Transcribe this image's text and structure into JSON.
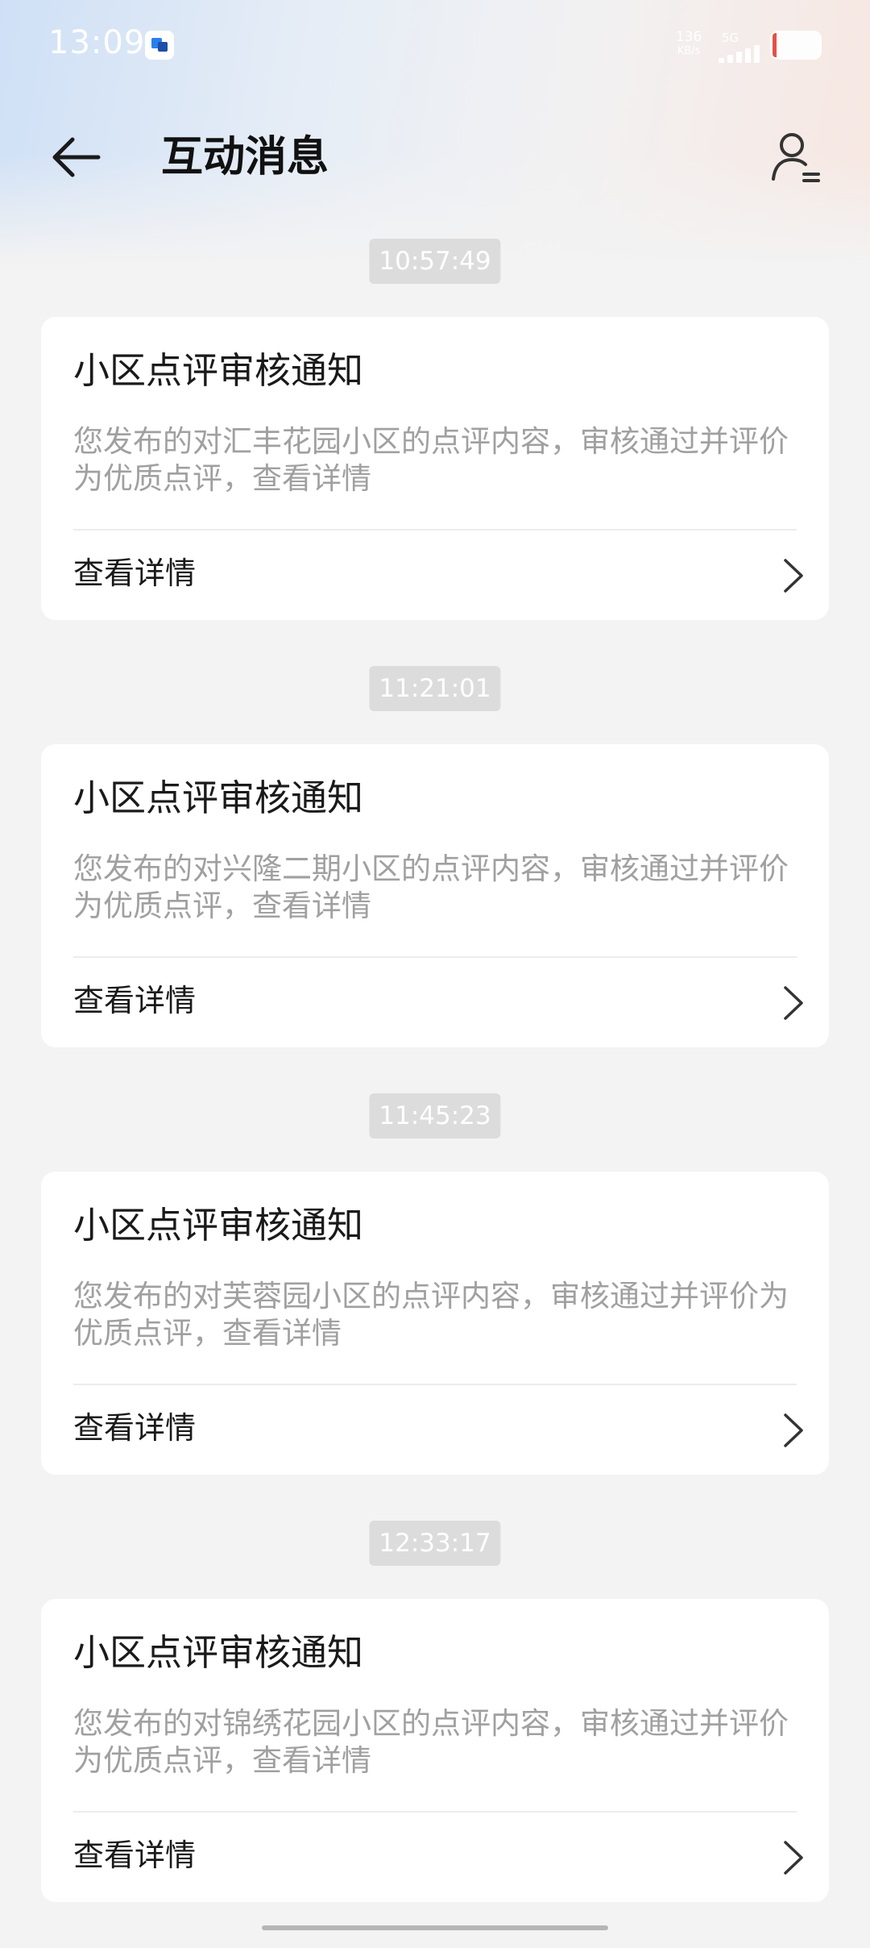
{
  "status_bar": {
    "time": "13:09",
    "net_speed_value": "136",
    "net_speed_unit": "KB/s",
    "network_type": "5G"
  },
  "header": {
    "title": "互动消息"
  },
  "messages": [
    {
      "timestamp": "10:57:49",
      "title": "小区点评审核通知",
      "description": "您发布的对汇丰花园小区的点评内容，审核通过并评价为优质点评，查看详情",
      "link_label": "查看详情"
    },
    {
      "timestamp": "11:21:01",
      "title": "小区点评审核通知",
      "description": "您发布的对兴隆二期小区的点评内容，审核通过并评价为优质点评，查看详情",
      "link_label": "查看详情"
    },
    {
      "timestamp": "11:45:23",
      "title": "小区点评审核通知",
      "description": "您发布的对芙蓉园小区的点评内容，审核通过并评价为优质点评，查看详情",
      "link_label": "查看详情"
    },
    {
      "timestamp": "12:33:17",
      "title": "小区点评审核通知",
      "description": "您发布的对锦绣花园小区的点评内容，审核通过并评价为优质点评，查看详情",
      "link_label": "查看详情"
    }
  ],
  "icons": {
    "back": "arrow-left-icon",
    "profile": "user-list-icon",
    "chevron": "chevron-right-icon"
  },
  "colors": {
    "background": "#f3f3f3",
    "card": "#ffffff",
    "timestamp_badge": "#dcdcdc",
    "description_text": "#a0a0a0",
    "battery_low": "#e5483f"
  }
}
